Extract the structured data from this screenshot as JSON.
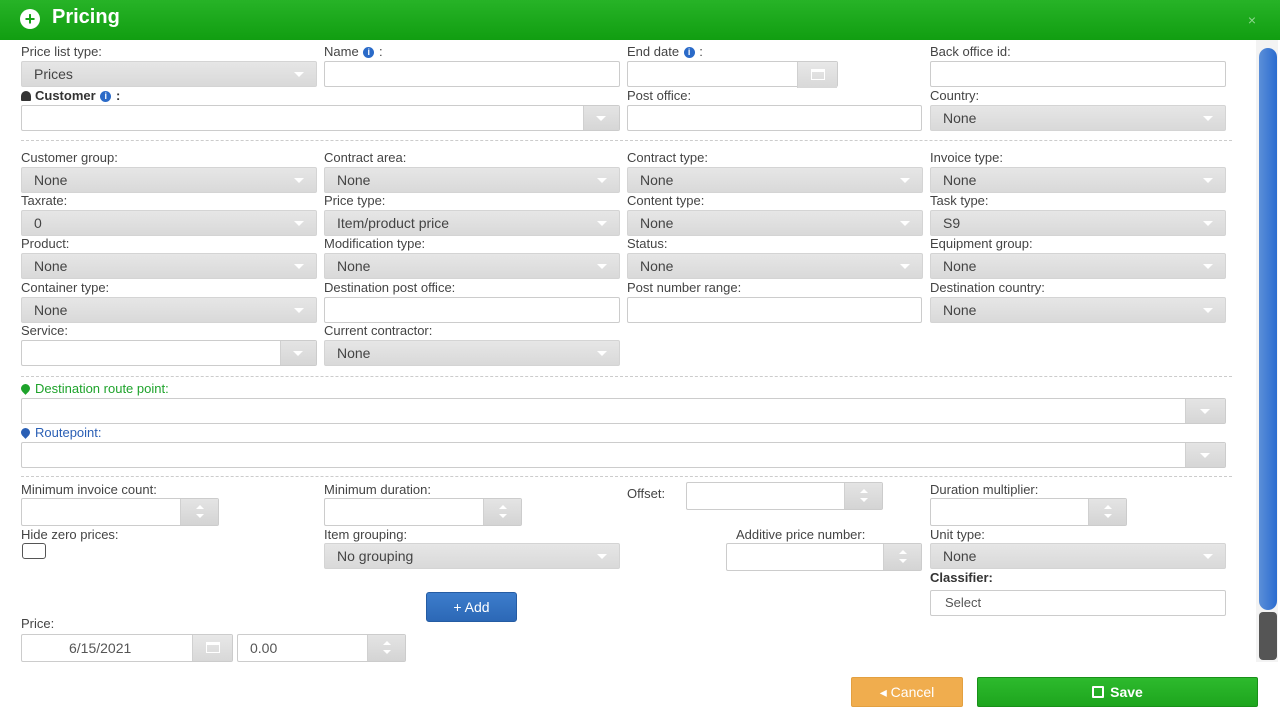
{
  "window": {
    "title": "Pricing",
    "close_glyph": "×"
  },
  "fields": {
    "price_list_type": {
      "label": "Price list type:",
      "value": "Prices"
    },
    "name": {
      "label": "Name",
      "suffix": ":"
    },
    "end_date": {
      "label": "End date",
      "suffix": ":"
    },
    "back_office_id": {
      "label": "Back office id:"
    },
    "customer": {
      "label": "Customer",
      "suffix": ":"
    },
    "post_office": {
      "label": "Post office:"
    },
    "country": {
      "label": "Country:",
      "value": "None"
    },
    "customer_group": {
      "label": "Customer group:",
      "value": "None"
    },
    "contract_area": {
      "label": "Contract area:",
      "value": "None"
    },
    "contract_type": {
      "label": "Contract type:",
      "value": "None"
    },
    "invoice_type": {
      "label": "Invoice type:",
      "value": "None"
    },
    "taxrate": {
      "label": "Taxrate:",
      "value": "0"
    },
    "price_type": {
      "label": "Price type:",
      "value": "Item/product price"
    },
    "content_type": {
      "label": "Content type:",
      "value": "None"
    },
    "task_type": {
      "label": "Task type:",
      "value": "S9"
    },
    "product": {
      "label": "Product:",
      "value": "None"
    },
    "modification_type": {
      "label": "Modification type:",
      "value": "None"
    },
    "status": {
      "label": "Status:",
      "value": "None"
    },
    "equipment_group": {
      "label": "Equipment group:",
      "value": "None"
    },
    "container_type": {
      "label": "Container type:",
      "value": "None"
    },
    "destination_post_office": {
      "label": "Destination post office:"
    },
    "post_number_range": {
      "label": "Post number range:"
    },
    "destination_country": {
      "label": "Destination country:",
      "value": "None"
    },
    "service": {
      "label": "Service:"
    },
    "current_contractor": {
      "label": "Current contractor:",
      "value": "None"
    },
    "destination_route_point": {
      "label": "Destination route point:"
    },
    "routepoint": {
      "label": "Routepoint:"
    },
    "minimum_invoice_count": {
      "label": "Minimum invoice count:"
    },
    "minimum_duration": {
      "label": "Minimum duration:"
    },
    "offset": {
      "label": "Offset:"
    },
    "duration_multiplier": {
      "label": "Duration multiplier:"
    },
    "hide_zero_prices": {
      "label": "Hide zero prices:"
    },
    "item_grouping": {
      "label": "Item grouping:",
      "value": "No grouping"
    },
    "additive_price_number": {
      "label": "Additive price number:"
    },
    "unit_type": {
      "label": "Unit type:",
      "value": "None"
    },
    "classifier": {
      "label": "Classifier:",
      "value": "Select"
    },
    "price": {
      "label": "Price:",
      "date": "6/15/2021",
      "amount": "0.00"
    }
  },
  "buttons": {
    "add": "+ Add",
    "cancel": "◂ Cancel",
    "save": "Save"
  },
  "icons": {
    "info": "i"
  },
  "colors": {
    "title_green": "#17a317",
    "accent_blue": "#2c68b6",
    "cancel_orange": "#f0ad4e",
    "save_green": "#1ea51e"
  }
}
